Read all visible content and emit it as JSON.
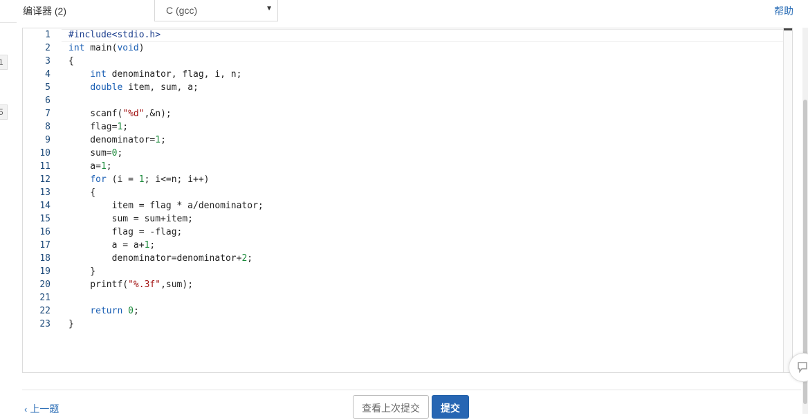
{
  "toolbar": {
    "compiler_label": "编译器 (2)",
    "language_selected": "C (gcc)",
    "help_label": "帮助"
  },
  "sidebar_stubs": [
    "1",
    "5"
  ],
  "editor": {
    "lines": [
      {
        "num": "1",
        "html": "<span class=\"pp\">#include&lt;stdio.h&gt;</span>"
      },
      {
        "num": "2",
        "html": "<span class=\"kw\">int</span> main(<span class=\"kw\">void</span>)"
      },
      {
        "num": "3",
        "html": "{"
      },
      {
        "num": "4",
        "html": "    <span class=\"kw\">int</span> denominator, flag, i, n;"
      },
      {
        "num": "5",
        "html": "    <span class=\"kw\">double</span> item, sum, a;"
      },
      {
        "num": "6",
        "html": ""
      },
      {
        "num": "7",
        "html": "    scanf(<span class=\"str\">\"%d\"</span>,&amp;n);"
      },
      {
        "num": "8",
        "html": "    flag=<span class=\"num\">1</span>;"
      },
      {
        "num": "9",
        "html": "    denominator=<span class=\"num\">1</span>;"
      },
      {
        "num": "10",
        "html": "    sum=<span class=\"num\">0</span>;"
      },
      {
        "num": "11",
        "html": "    a=<span class=\"num\">1</span>;"
      },
      {
        "num": "12",
        "html": "    <span class=\"kw\">for</span> (i = <span class=\"num\">1</span>; i&lt;=n; i++)"
      },
      {
        "num": "13",
        "html": "    {"
      },
      {
        "num": "14",
        "html": "        item = flag * a/denominator;"
      },
      {
        "num": "15",
        "html": "        sum = sum+item;"
      },
      {
        "num": "16",
        "html": "        flag = -flag;"
      },
      {
        "num": "17",
        "html": "        a = a+<span class=\"num\">1</span>;"
      },
      {
        "num": "18",
        "html": "        denominator=denominator+<span class=\"num\">2</span>;"
      },
      {
        "num": "19",
        "html": "    }"
      },
      {
        "num": "20",
        "html": "    printf(<span class=\"str\">\"%.3f\"</span>,sum);"
      },
      {
        "num": "21",
        "html": ""
      },
      {
        "num": "22",
        "html": "    <span class=\"kw\">return</span> <span class=\"num\">0</span>;"
      },
      {
        "num": "23",
        "html": "}"
      }
    ]
  },
  "footer": {
    "prev_label": "上一题",
    "view_last_label": "查看上次提交",
    "submit_label": "提交"
  },
  "colors": {
    "accent": "#2766b3",
    "link": "#2d6fb7",
    "keyword": "#1a5fb4",
    "number": "#1a8a3a",
    "string": "#a31515"
  }
}
